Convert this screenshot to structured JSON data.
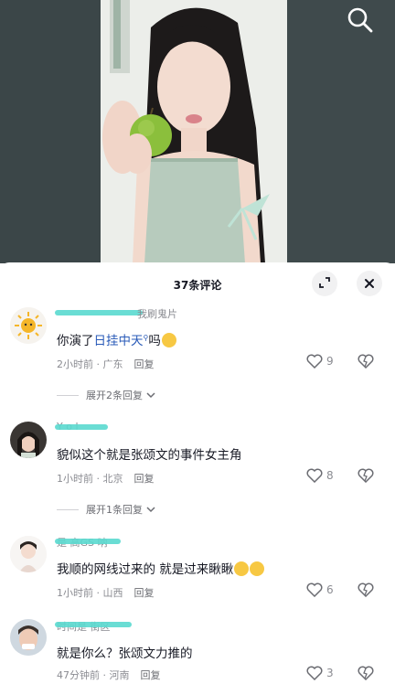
{
  "header": {
    "search_icon": "search-icon",
    "sheet_title": "37条评论"
  },
  "comments": [
    {
      "username": "我刷鬼片",
      "text_prefix": "你演了",
      "text_link": "日挂中天",
      "text_suffix": "吗",
      "time": "2小时前",
      "location": "广东",
      "reply_label": "回复",
      "likes": "9",
      "expand_label": "展开2条回复"
    },
    {
      "username": "Y o l",
      "text": "貌似这个就是张颂文的事件女主角",
      "time": "1小时前",
      "location": "北京",
      "reply_label": "回复",
      "likes": "8",
      "expand_label": "展开1条回复"
    },
    {
      "username": "是 高GS 呐",
      "text": "我顺的网线过来的 就是过来瞅瞅",
      "time": "1小时前",
      "location": "山西",
      "reply_label": "回复",
      "likes": "6"
    },
    {
      "username": "时间是 街区",
      "text": "就是你么？张颂文力推的",
      "time": "47分钟前",
      "location": "河南",
      "reply_label": "回复",
      "likes": "3"
    }
  ],
  "colors": {
    "accent": "#2a5bb8",
    "highlight": "#5ad9cf"
  }
}
